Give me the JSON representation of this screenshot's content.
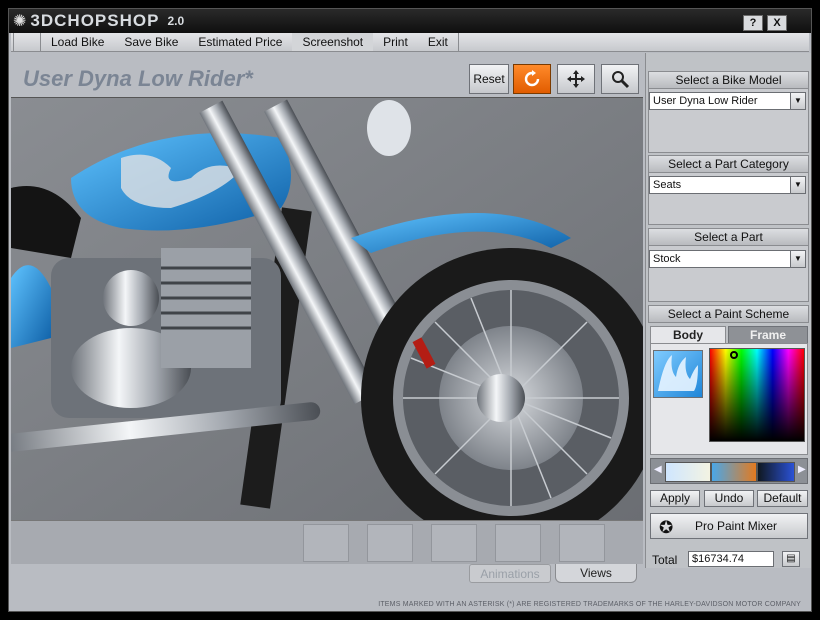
{
  "app": {
    "brand": "3DCHOPSHOP",
    "version": "2.0",
    "help_label": "?",
    "close_label": "X"
  },
  "menu": {
    "items": [
      {
        "label": "Load Bike"
      },
      {
        "label": "Save Bike"
      },
      {
        "label": "Estimated Price"
      },
      {
        "label": "Screenshot"
      },
      {
        "label": "Print"
      },
      {
        "label": "Exit"
      }
    ]
  },
  "toolbar": {
    "bike_title": "User Dyna Low Rider*",
    "reset_label": "Reset"
  },
  "view_tabs": {
    "animations": "Animations",
    "views": "Views"
  },
  "footer": {
    "trademark": "ITEMS MARKED WITH AN ASTERISK (*) ARE REGISTERED TRADEMARKS OF THE HARLEY-DAVIDSON MOTOR COMPANY"
  },
  "panel": {
    "bike_model": {
      "header": "Select a Bike Model",
      "value": "User Dyna Low Rider"
    },
    "part_category": {
      "header": "Select a Part Category",
      "value": "Seats"
    },
    "part": {
      "header": "Select a Part",
      "value": "Stock"
    },
    "paint_scheme": {
      "header": "Select a Paint Scheme",
      "tab_body": "Body",
      "tab_frame": "Frame",
      "apply": "Apply",
      "undo": "Undo",
      "default": "Default",
      "mixer": "Pro Paint Mixer"
    },
    "total": {
      "label": "Total",
      "value": "$16734.74"
    }
  },
  "colors": {
    "accent_orange": "#e86a0c",
    "flame_blue": "#1f86d8",
    "title_gray": "#7b8594"
  }
}
